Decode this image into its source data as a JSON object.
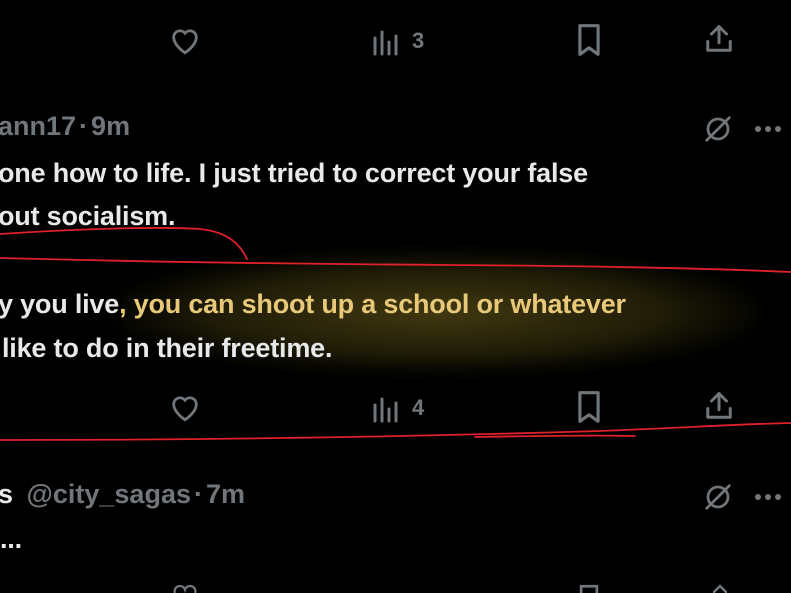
{
  "top_action_bar": {
    "views_count": "3"
  },
  "tweet1": {
    "handle_partial": "ann17",
    "dot": "·",
    "time": "9m",
    "line1": "one how to life. I just tried to correct your false",
    "line2": "out socialism.",
    "line3_start": "y you live",
    "line3_highlight": ", you can shoot up a school or whatever",
    "line4": "like to do in their freetime.",
    "views_count": "4"
  },
  "tweet2": {
    "name_partial": "s",
    "handle": "@city_sagas",
    "dot": "·",
    "time": "7m",
    "text_partial": "..."
  },
  "colors": {
    "background": "#000000",
    "text": "#e7e9ea",
    "muted": "#71767b",
    "highlight_text": "#e8c97a",
    "annotation_red": "#e0202a"
  }
}
